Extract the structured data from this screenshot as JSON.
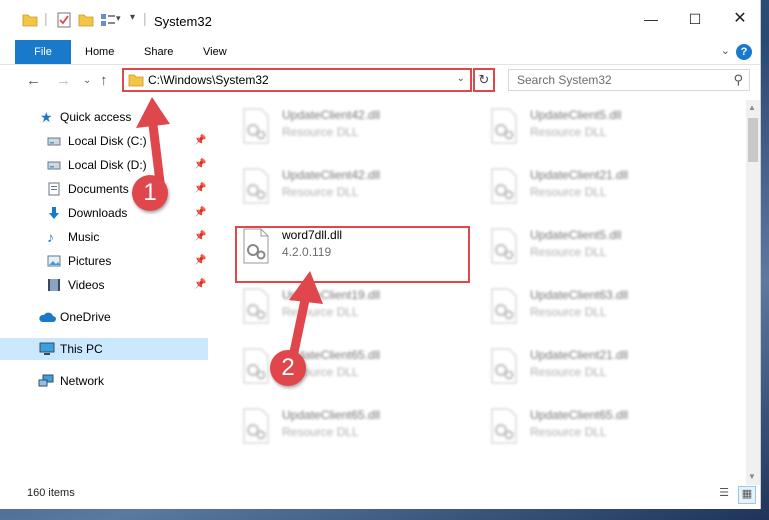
{
  "window": {
    "title": "System32",
    "colors": {
      "accent": "#1979ca",
      "highlight": "#e0474c",
      "selection": "#cce8ff"
    }
  },
  "ribbon": {
    "tabs": [
      "File",
      "Home",
      "Share",
      "View"
    ]
  },
  "address": {
    "path": "C:\\Windows\\System32",
    "search_placeholder": "Search System32"
  },
  "sidebar": {
    "items": [
      {
        "label": "Quick access",
        "icon": "star-icon"
      },
      {
        "label": "Local Disk (C:)",
        "icon": "drive-icon",
        "pinned": true
      },
      {
        "label": "Local Disk (D:)",
        "icon": "drive-icon",
        "pinned": true
      },
      {
        "label": "Documents",
        "icon": "documents-icon",
        "pinned": true
      },
      {
        "label": "Downloads",
        "icon": "download-icon",
        "pinned": true
      },
      {
        "label": "Music",
        "icon": "music-icon",
        "pinned": true
      },
      {
        "label": "Pictures",
        "icon": "pictures-icon",
        "pinned": true
      },
      {
        "label": "Videos",
        "icon": "videos-icon",
        "pinned": true
      },
      {
        "label": "OneDrive",
        "icon": "cloud-icon"
      },
      {
        "label": "This PC",
        "icon": "computer-icon",
        "selected": true
      },
      {
        "label": "Network",
        "icon": "network-icon"
      }
    ]
  },
  "files": [
    {
      "name": "UpdateClient42.dll",
      "sub": "Resource DLL"
    },
    {
      "name": "UpdateClient5.dll",
      "sub": "Resource DLL"
    },
    {
      "name": "UpdateClient42.dll",
      "sub": "Resource DLL"
    },
    {
      "name": "UpdateClient21.dll",
      "sub": "Resource DLL"
    },
    {
      "name": "word7dll.dll",
      "sub": "4.2.0.119"
    },
    {
      "name": "UpdateClient5.dll",
      "sub": "Resource DLL"
    },
    {
      "name": "UpdateClient19.dll",
      "sub": "Resource DLL"
    },
    {
      "name": "UpdateClient63.dll",
      "sub": "Resource DLL"
    },
    {
      "name": "UpdateClient65.dll",
      "sub": "Resource DLL"
    },
    {
      "name": "UpdateClient21.dll",
      "sub": "Resource DLL"
    },
    {
      "name": "UpdateClient65.dll",
      "sub": "Resource DLL"
    },
    {
      "name": "UpdateClient65.dll",
      "sub": "Resource DLL"
    }
  ],
  "status": {
    "count": "160 items"
  },
  "annotations": {
    "step1": "1",
    "step2": "2"
  }
}
